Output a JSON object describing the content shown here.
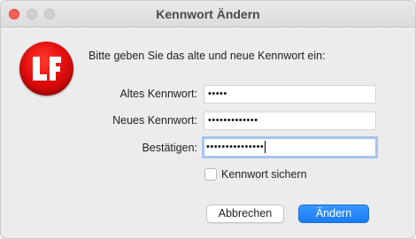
{
  "window": {
    "title": "Kennwort Ändern"
  },
  "logo": {
    "text": "LF"
  },
  "dialog": {
    "prompt": "Bitte geben Sie das alte und neue Kennwort ein:",
    "fields": [
      {
        "label": "Altes Kennwort:",
        "value": "•••••"
      },
      {
        "label": "Neues Kennwort:",
        "value": "•••••••••••••"
      },
      {
        "label": "Bestätigen:",
        "value": "•••••••••••••••"
      }
    ],
    "checkbox": {
      "label": "Kennwort sichern",
      "checked": false
    },
    "buttons": {
      "cancel": "Abbrechen",
      "ok": "Ändern"
    }
  },
  "colors": {
    "accent": "#1a7cf4",
    "focus_ring": "#a7c4ee",
    "logo_red": "#e30f0f"
  }
}
